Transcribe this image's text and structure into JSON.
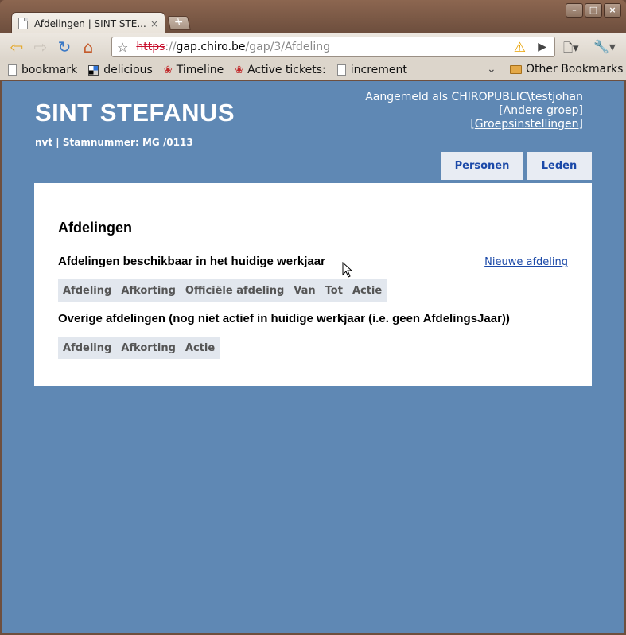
{
  "browser": {
    "tab": {
      "title": "Afdelingen | SINT STE...",
      "close": "×"
    },
    "new_tab": "+",
    "window_buttons": {
      "minimize": "–",
      "maximize": "□",
      "close": "×"
    },
    "toolbar": {
      "back": "⇦",
      "forward": "⇨",
      "reload": "↻",
      "home": "⌂",
      "star": "☆",
      "url": {
        "scheme": "https",
        "sep": "://",
        "host": "gap.chiro.be",
        "path": "/gap/3/Afdeling"
      },
      "warning": "⚠",
      "go": "▶",
      "page_menu": "🗋▾",
      "wrench": "🔧▾"
    },
    "bookmarks": [
      {
        "label": "bookmark",
        "icon": "document-icon"
      },
      {
        "label": "delicious",
        "icon": "delicious-icon"
      },
      {
        "label": "Timeline",
        "icon": "paw-icon"
      },
      {
        "label": "Active tickets:",
        "icon": "paw-icon"
      },
      {
        "label": "increment",
        "icon": "document-icon"
      }
    ],
    "bookmarks_chevron": "⌄",
    "other_bookmarks": "Other Bookmarks"
  },
  "page": {
    "site_title": "SINT STEFANUS",
    "subtitle": "nvt | Stamnummer: MG /0113",
    "user": {
      "logged_in_as": "Aangemeld als CHIROPUBLIC\\testjohan",
      "other_group": "Andere groep",
      "group_settings": "Groepsinstellingen",
      "bracket_open": "[",
      "bracket_close": "]"
    },
    "nav": {
      "personen": "Personen",
      "leden": "Leden"
    },
    "heading": "Afdelingen",
    "section1": {
      "title": "Afdelingen beschikbaar in het huidige werkjaar",
      "new_link": "Nieuwe afdeling",
      "columns": [
        "Afdeling",
        "Afkorting",
        "Officiële afdeling",
        "Van",
        "Tot",
        "Actie"
      ]
    },
    "section2": {
      "title": "Overige afdelingen (nog niet actief in huidige werkjaar (i.e. geen AfdelingsJaar))",
      "columns": [
        "Afdeling",
        "Afkorting",
        "Actie"
      ]
    }
  },
  "colors": {
    "page_bg": "#5f88b4",
    "link": "#1b49a8",
    "nav_tab_bg": "#e8ecf3",
    "table_head_bg": "#e2e7ee"
  }
}
